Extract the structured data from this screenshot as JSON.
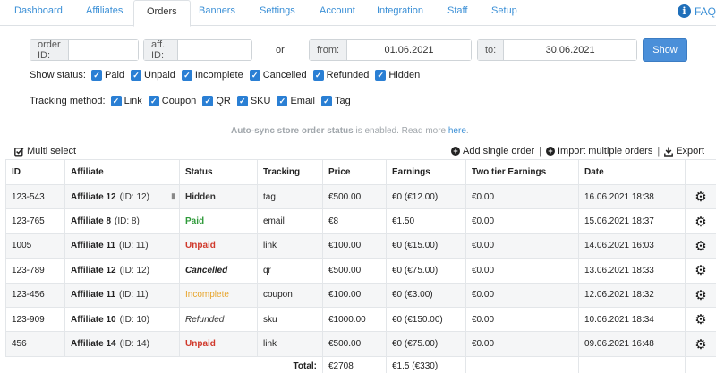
{
  "tabs": {
    "items": [
      {
        "label": "Dashboard",
        "active": false
      },
      {
        "label": "Affiliates",
        "active": false
      },
      {
        "label": "Orders",
        "active": true
      },
      {
        "label": "Banners",
        "active": false
      },
      {
        "label": "Settings",
        "active": false
      },
      {
        "label": "Account",
        "active": false
      },
      {
        "label": "Integration",
        "active": false
      },
      {
        "label": "Staff",
        "active": false
      },
      {
        "label": "Setup",
        "active": false
      }
    ],
    "faq_label": "FAQ",
    "faq_icon": "i"
  },
  "filters": {
    "order_id_label": "order ID:",
    "order_id_value": "",
    "aff_id_label": "aff. ID:",
    "aff_id_value": "",
    "or_label": "or",
    "from_label": "from:",
    "from_value": "01.06.2021",
    "to_label": "to:",
    "to_value": "30.06.2021",
    "show_button": "Show"
  },
  "show_status": {
    "label": "Show status:",
    "options": [
      {
        "label": "Paid",
        "checked": true
      },
      {
        "label": "Unpaid",
        "checked": true
      },
      {
        "label": "Incomplete",
        "checked": true
      },
      {
        "label": "Cancelled",
        "checked": true
      },
      {
        "label": "Refunded",
        "checked": true
      },
      {
        "label": "Hidden",
        "checked": true
      }
    ]
  },
  "tracking_method": {
    "label": "Tracking method:",
    "options": [
      {
        "label": "Link",
        "checked": true
      },
      {
        "label": "Coupon",
        "checked": true
      },
      {
        "label": "QR",
        "checked": true
      },
      {
        "label": "SKU",
        "checked": true
      },
      {
        "label": "Email",
        "checked": true
      },
      {
        "label": "Tag",
        "checked": true
      }
    ]
  },
  "sync_notice": {
    "bold": "Auto-sync store order status",
    "text": " is enabled. Read more ",
    "link": "here",
    "tail": "."
  },
  "toolbar": {
    "multi_select": "Multi select",
    "add_single": "Add single order",
    "import_multiple": "Import multiple orders",
    "export": "Export",
    "separator": "|"
  },
  "table": {
    "headers": [
      "ID",
      "Affiliate",
      "Status",
      "Tracking",
      "Price",
      "Earnings",
      "Two tier Earnings",
      "Date",
      ""
    ],
    "rows": [
      {
        "id": "123-543",
        "affiliate": "Affiliate 12",
        "aff_id": "(ID: 12)",
        "status": "Hidden",
        "status_class": "st-hidden",
        "tracking": "tag",
        "price": "€500.00",
        "earnings": "€0 (€12.00)",
        "two_tier": "€0.00",
        "date": "16.06.2021 18:38",
        "has_note": true
      },
      {
        "id": "123-765",
        "affiliate": "Affiliate 8",
        "aff_id": "(ID: 8)",
        "status": "Paid",
        "status_class": "st-paid",
        "tracking": "email",
        "price": "€8",
        "earnings": "€1.50",
        "two_tier": "€0.00",
        "date": "15.06.2021 18:37",
        "has_note": false
      },
      {
        "id": "1005",
        "affiliate": "Affiliate 11",
        "aff_id": "(ID: 11)",
        "status": "Unpaid",
        "status_class": "st-unpaid",
        "tracking": "link",
        "price": "€100.00",
        "earnings": "€0 (€15.00)",
        "two_tier": "€0.00",
        "date": "14.06.2021 16:03",
        "has_note": false
      },
      {
        "id": "123-789",
        "affiliate": "Affiliate 12",
        "aff_id": "(ID: 12)",
        "status": "Cancelled",
        "status_class": "st-cancelled",
        "tracking": "qr",
        "price": "€500.00",
        "earnings": "€0 (€75.00)",
        "two_tier": "€0.00",
        "date": "13.06.2021 18:33",
        "has_note": false
      },
      {
        "id": "123-456",
        "affiliate": "Affiliate 11",
        "aff_id": "(ID: 11)",
        "status": "Incomplete",
        "status_class": "st-incomplete",
        "tracking": "coupon",
        "price": "€100.00",
        "earnings": "€0 (€3.00)",
        "two_tier": "€0.00",
        "date": "12.06.2021 18:32",
        "has_note": false
      },
      {
        "id": "123-909",
        "affiliate": "Affiliate 10",
        "aff_id": "(ID: 10)",
        "status": "Refunded",
        "status_class": "st-refunded",
        "tracking": "sku",
        "price": "€1000.00",
        "earnings": "€0 (€150.00)",
        "two_tier": "€0.00",
        "date": "10.06.2021 18:34",
        "has_note": false
      },
      {
        "id": "456",
        "affiliate": "Affiliate 14",
        "aff_id": "(ID: 14)",
        "status": "Unpaid",
        "status_class": "st-unpaid",
        "tracking": "link",
        "price": "€500.00",
        "earnings": "€0 (€75.00)",
        "two_tier": "€0.00",
        "date": "09.06.2021 16:48",
        "has_note": false
      }
    ],
    "footer": {
      "label": "Total:",
      "price": "€2708",
      "earnings": "€1.5 (€330)"
    }
  },
  "colors": {
    "accent": "#3a8fd6",
    "checkbox": "#2a7fd4",
    "paid": "#2f9a3a",
    "unpaid": "#d0392b",
    "incomplete": "#e7a42a"
  },
  "icons": {
    "row_action": "gear-icon",
    "note": "comment-icon",
    "multi_select": "check-square-icon",
    "add": "plus-circle-icon",
    "import": "plus-circle-icon",
    "export": "download-icon"
  }
}
